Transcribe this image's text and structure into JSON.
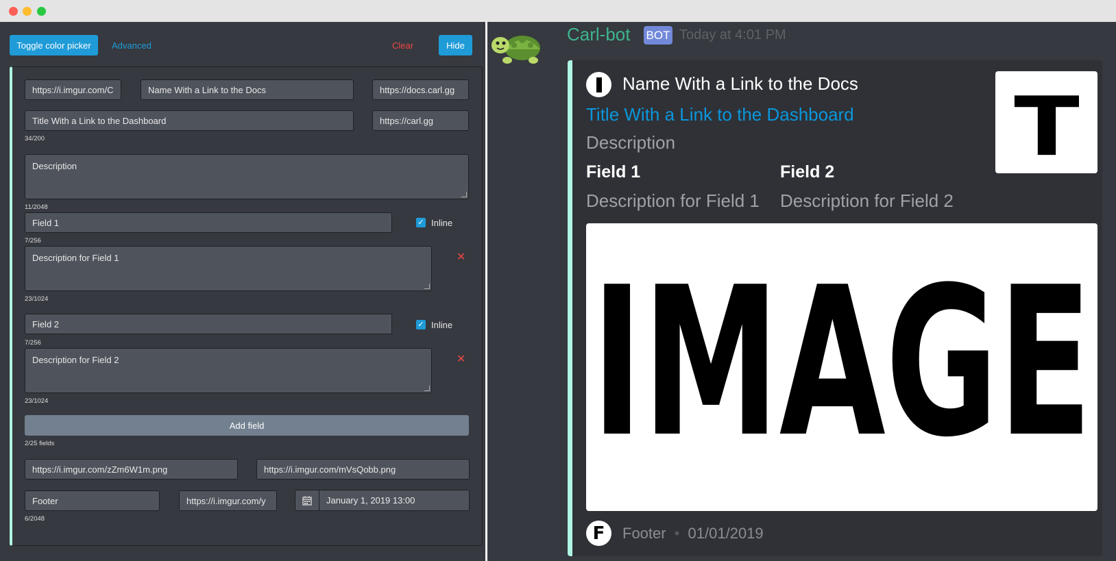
{
  "window": {
    "controls": [
      "close",
      "minimize",
      "maximize"
    ]
  },
  "toolbar": {
    "toggle_color_picker": "Toggle color picker",
    "advanced": "Advanced",
    "clear": "Clear",
    "hide": "Hide"
  },
  "form": {
    "author_icon_url": "https://i.imgur.com/C",
    "author_name": "Name With a Link to the Docs",
    "author_url": "https://docs.carl.gg",
    "title": "Title With a Link to the Dashboard",
    "title_url": "https://carl.gg",
    "title_count": "34/200",
    "description": "Description",
    "description_count": "11/2048",
    "fields": [
      {
        "name": "Field 1",
        "name_count": "7/256",
        "inline_label": "Inline",
        "inline": true,
        "value": "Description for Field 1",
        "value_count": "23/1024",
        "remove": "✕"
      },
      {
        "name": "Field 2",
        "name_count": "7/256",
        "inline_label": "Inline",
        "inline": true,
        "value": "Description for Field 2",
        "value_count": "23/1024",
        "remove": "✕"
      }
    ],
    "add_field": "Add field",
    "fields_count": "2/25 fields",
    "image_url": "https://i.imgur.com/zZm6W1m.png",
    "thumbnail_url": "https://i.imgur.com/mVsQobb.png",
    "footer": "Footer",
    "footer_icon_url": "https://i.imgur.com/y",
    "timestamp": "January 1, 2019 13:00",
    "footer_count": "6/2048"
  },
  "preview": {
    "username": "Carl-bot",
    "bot_badge": "BOT",
    "timestamp": "Today at 4:01 PM",
    "embed_color": "#aff5e4",
    "author_name": "Name With a Link to the Docs",
    "title": "Title With a Link to the Dashboard",
    "description": "Description",
    "fields": [
      {
        "name": "Field 1",
        "value": "Description for Field 1"
      },
      {
        "name": "Field 2",
        "value": "Description for Field 2"
      }
    ],
    "thumbnail_text": "T",
    "image_text": "IMAGE",
    "footer_icon_text": "F",
    "footer": "Footer",
    "footer_sep": "•",
    "footer_date": "01/01/2019"
  }
}
